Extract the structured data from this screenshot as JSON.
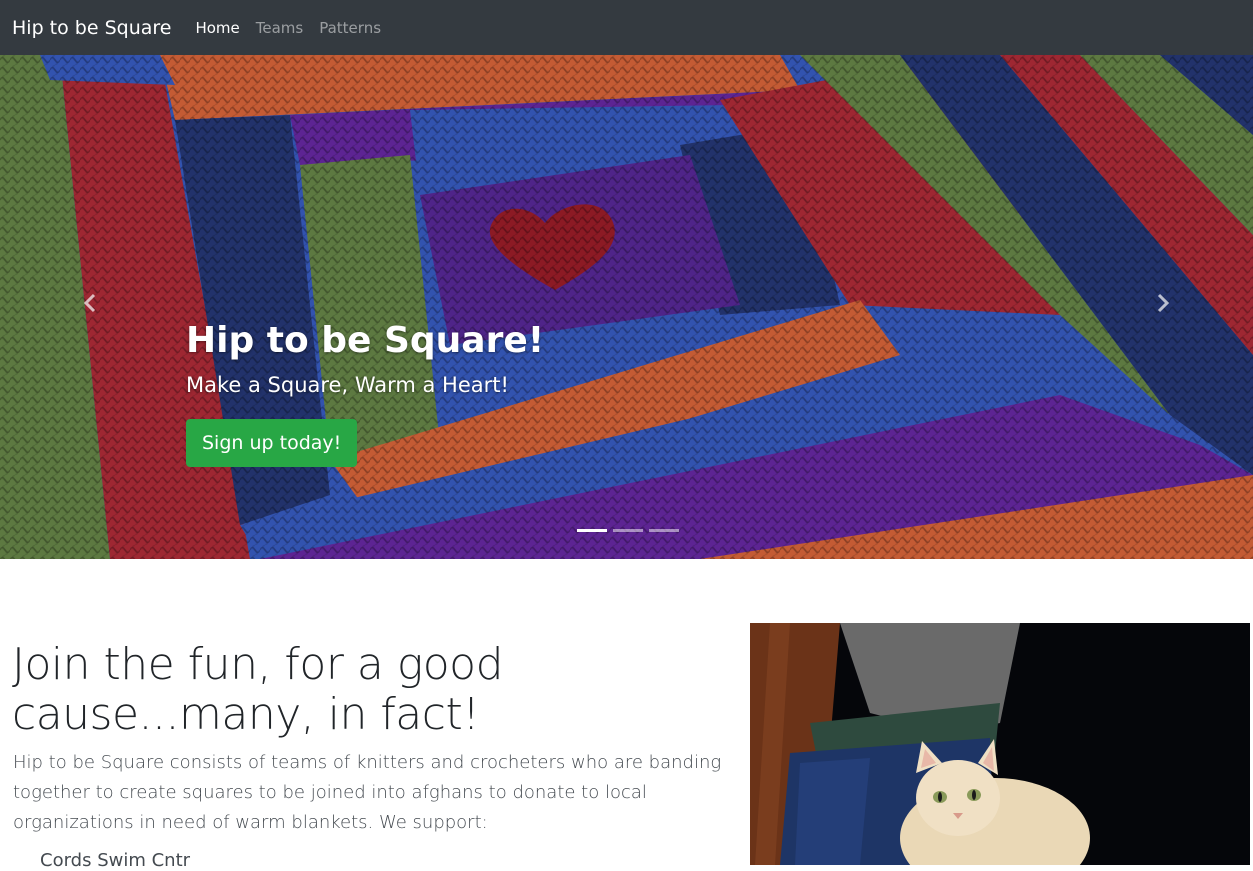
{
  "navbar": {
    "brand": "Hip to be Square",
    "links": [
      {
        "label": "Home",
        "active": true
      },
      {
        "label": "Teams",
        "active": false
      },
      {
        "label": "Patterns",
        "active": false
      }
    ]
  },
  "carousel": {
    "title": "Hip to be Square!",
    "subtitle": "Make a Square, Warm a Heart!",
    "cta_label": "Sign up today!",
    "slide_count": 3,
    "active_slide": 1,
    "prev_icon": "chevron-left-icon",
    "next_icon": "chevron-right-icon"
  },
  "content": {
    "heading": "Join the fun, for a good cause...many, in fact!",
    "lead": "Hip to be Square consists of teams of knitters and crocheters who are banding together to create squares to be joined into afghans to donate to local organizations in need of warm blankets. We support:",
    "list_items": [
      "Cords Swim Cntr"
    ]
  },
  "colors": {
    "navbar_bg": "#343a40",
    "cta_bg": "#28a745",
    "text": "#212529"
  }
}
